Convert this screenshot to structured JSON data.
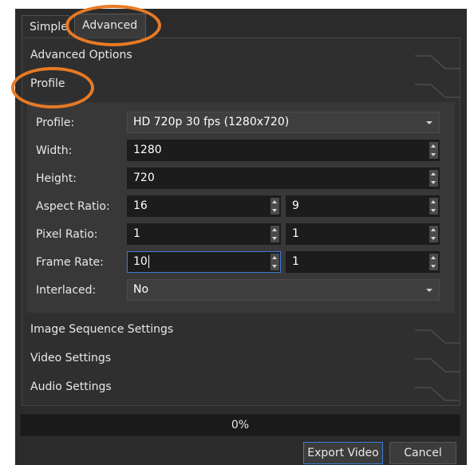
{
  "tabs": [
    {
      "label": "Simple"
    },
    {
      "label": "Advanced"
    }
  ],
  "sections": {
    "advanced_options": "Advanced Options",
    "profile": "Profile",
    "image_sequence": "Image Sequence Settings",
    "video": "Video Settings",
    "audio": "Audio Settings"
  },
  "profile": {
    "profile_label": "Profile:",
    "profile_value": "HD 720p 30 fps (1280x720)",
    "width_label": "Width:",
    "width_value": "1280",
    "height_label": "Height:",
    "height_value": "720",
    "aspect_label": "Aspect Ratio:",
    "aspect_num": "16",
    "aspect_den": "9",
    "pixel_label": "Pixel Ratio:",
    "pixel_num": "1",
    "pixel_den": "1",
    "frame_label": "Frame Rate:",
    "frame_num": "10",
    "frame_den": "1",
    "interlaced_label": "Interlaced:",
    "interlaced_value": "No"
  },
  "progress": {
    "text": "0%",
    "value": 0
  },
  "buttons": {
    "export": "Export Video",
    "cancel": "Cancel"
  },
  "colors": {
    "accent": "#3d7bd9",
    "annotation": "#e87a25"
  },
  "icons": [
    "dropdown-arrow-icon",
    "spin-up-icon",
    "spin-down-icon",
    "section-collapse-icon"
  ]
}
